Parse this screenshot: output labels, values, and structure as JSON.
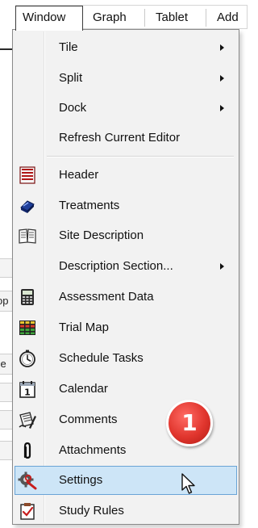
{
  "menubar": {
    "items": [
      {
        "label": "Window",
        "active": true
      },
      {
        "label": "Graph"
      },
      {
        "label": "Tablet"
      },
      {
        "label": "Add"
      }
    ]
  },
  "background": {
    "fragment_op": "op",
    "fragment_ze": "ze"
  },
  "menu": {
    "items": [
      {
        "label": "Tile",
        "submenu": true,
        "icon": "none"
      },
      {
        "label": "Split",
        "submenu": true,
        "icon": "none"
      },
      {
        "label": "Dock",
        "submenu": true,
        "icon": "none"
      },
      {
        "label": "Refresh Current Editor",
        "submenu": false,
        "icon": "none"
      },
      {
        "label": "Header",
        "submenu": false,
        "icon": "header-icon"
      },
      {
        "label": "Treatments",
        "submenu": false,
        "icon": "treatments-icon"
      },
      {
        "label": "Site Description",
        "submenu": false,
        "icon": "site-description-icon"
      },
      {
        "label": "Description Section...",
        "submenu": true,
        "icon": "none"
      },
      {
        "label": "Assessment Data",
        "submenu": false,
        "icon": "assessment-data-icon"
      },
      {
        "label": "Trial Map",
        "submenu": false,
        "icon": "trial-map-icon"
      },
      {
        "label": "Schedule Tasks",
        "submenu": false,
        "icon": "schedule-tasks-icon"
      },
      {
        "label": "Calendar",
        "submenu": false,
        "icon": "calendar-icon"
      },
      {
        "label": "Comments",
        "submenu": false,
        "icon": "comments-icon"
      },
      {
        "label": "Attachments",
        "submenu": false,
        "icon": "attachments-icon"
      },
      {
        "label": "Settings",
        "submenu": false,
        "icon": "settings-icon",
        "highlighted": true
      },
      {
        "label": "Study Rules",
        "submenu": false,
        "icon": "study-rules-icon"
      }
    ]
  },
  "callout": {
    "number": "1",
    "color": "#e0352d"
  },
  "calendar_icon_digit": "1",
  "colors": {
    "highlight_bg": "#cde5f7",
    "highlight_border": "#6aa4d6",
    "menu_bg": "#f2f2f2"
  }
}
